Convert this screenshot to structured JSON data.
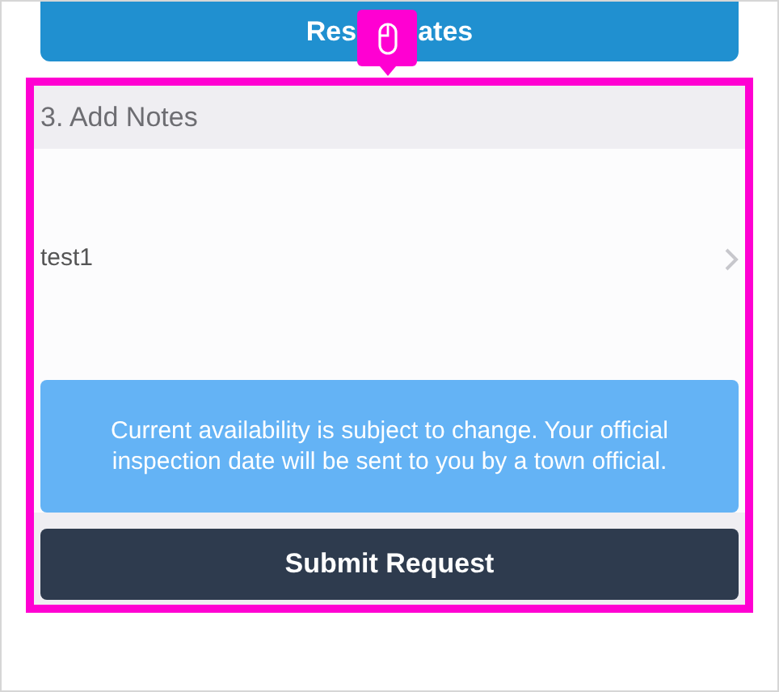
{
  "top_button": {
    "label_left": "Res",
    "label_right": "ates"
  },
  "highlight": {
    "badge": {
      "kind": "mouse"
    }
  },
  "section": {
    "title": "3. Add Notes",
    "notes": [
      {
        "text": "test1"
      }
    ],
    "info": "Current availability is subject to change. Your official inspection date will be sent to you by a town official.",
    "submit": "Submit Request"
  }
}
